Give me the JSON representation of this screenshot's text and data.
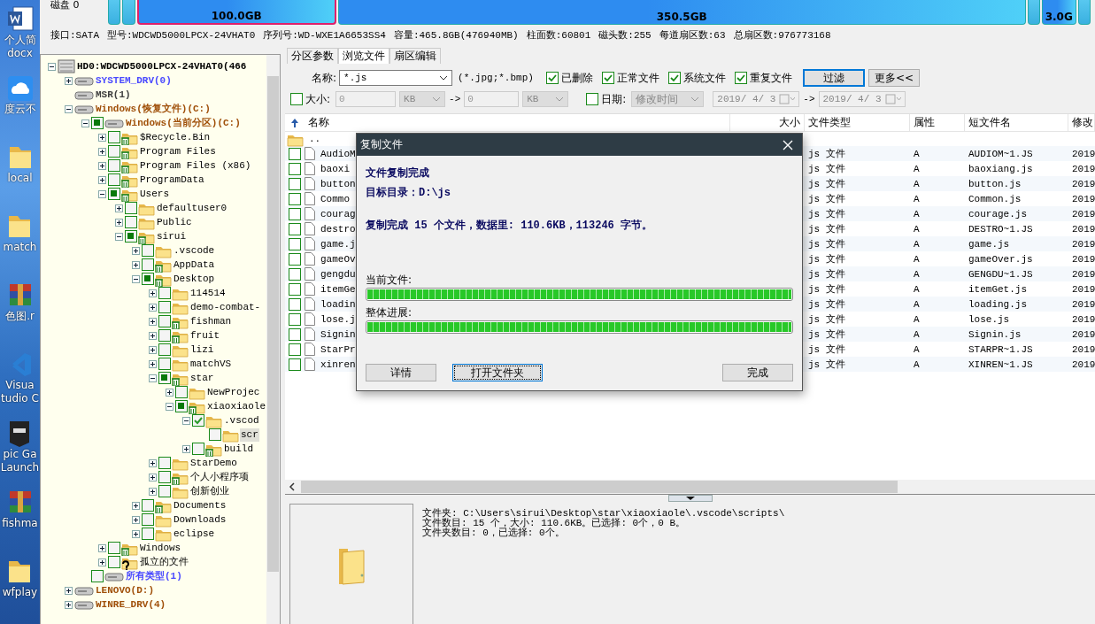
{
  "desktop_icons": [
    {
      "kind": "word",
      "lines": [
        "个人简",
        "docx"
      ]
    },
    {
      "kind": "cloud",
      "lines": [
        "度云不"
      ]
    },
    {
      "kind": "folder",
      "lines": [
        "local"
      ]
    },
    {
      "kind": "folder",
      "lines": [
        "match"
      ]
    },
    {
      "kind": "archive",
      "lines": [
        "色图.r"
      ]
    },
    {
      "kind": "code",
      "lines": [
        "Visua",
        "tudio C"
      ]
    },
    {
      "kind": "epic",
      "lines": [
        "pic Ga",
        "Launch"
      ]
    },
    {
      "kind": "archive",
      "lines": [
        "fishma"
      ]
    },
    {
      "kind": "folder",
      "lines": [
        "wfplay"
      ]
    }
  ],
  "disk_map": {
    "label": "磁盘 0",
    "partitions": [
      {
        "kind": "sliver",
        "selected": false
      },
      {
        "kind": "sliver",
        "selected": false
      },
      {
        "kind": "ntfs",
        "label": "100.0GB",
        "selected": true
      },
      {
        "kind": "ntfs",
        "label": "350.5GB",
        "selected": false
      },
      {
        "kind": "sliver",
        "selected": false
      },
      {
        "kind": "ntfs",
        "label": "3.0G",
        "selected": false
      },
      {
        "kind": "sliver",
        "selected": false
      }
    ]
  },
  "disk_info": [
    "接口:SATA",
    "型号:WDCWD5000LPCX-24VHAT0",
    "序列号:WD-WXE1A6653SS4",
    "容量:465.8GB(476940MB)",
    "柱面数:60801",
    "磁头数:255",
    "每道扇区数:63",
    "总扇区数:976773168"
  ],
  "tree": {
    "root": {
      "kind": "disk",
      "label": "HD0:WDCWD5000LPCX-24VHAT0(466",
      "expanded": true,
      "selected": false,
      "children": [
        {
          "kind": "partition",
          "label": "SYSTEM_DRV(0)",
          "color": "#4a4aff",
          "expanded": false,
          "selected": false
        },
        {
          "kind": "partition",
          "label": "MSR(1)",
          "color": "#404040",
          "selected": false
        },
        {
          "kind": "partition",
          "label": "Windows(恢复文件)(C:)",
          "color": "#a0500a",
          "expanded": true,
          "selected": false,
          "children": [
            {
              "kind": "partition",
              "label": "Windows(当前分区)(C:)",
              "color": "#a0500a",
              "checked": false,
              "partial": true,
              "expanded": true,
              "selected": false,
              "children": [
                {
                  "kind": "folder-deleted",
                  "label": "$Recycle.Bin",
                  "checked": false,
                  "partial": false,
                  "expanded": false,
                  "selected": false
                },
                {
                  "kind": "folder-deleted",
                  "label": "Program Files",
                  "checked": false,
                  "partial": false,
                  "expanded": false,
                  "selected": false
                },
                {
                  "kind": "folder-deleted",
                  "label": "Program Files (x86)",
                  "checked": false,
                  "partial": false,
                  "expanded": false,
                  "selected": false
                },
                {
                  "kind": "folder-deleted",
                  "label": "ProgramData",
                  "checked": false,
                  "partial": false,
                  "expanded": false,
                  "selected": false
                },
                {
                  "kind": "folder-deleted",
                  "label": "Users",
                  "checked": false,
                  "partial": true,
                  "expanded": true,
                  "selected": false,
                  "children": [
                    {
                      "kind": "folder",
                      "label": "defaultuser0",
                      "checked": false,
                      "partial": false,
                      "expanded": false,
                      "selected": false
                    },
                    {
                      "kind": "folder",
                      "label": "Public",
                      "checked": false,
                      "partial": false,
                      "expanded": false,
                      "selected": false
                    },
                    {
                      "kind": "folder-deleted",
                      "label": "sirui",
                      "checked": false,
                      "partial": true,
                      "expanded": true,
                      "selected": false,
                      "children": [
                        {
                          "kind": "folder",
                          "label": ".vscode",
                          "checked": false,
                          "partial": false,
                          "expanded": false,
                          "selected": false
                        },
                        {
                          "kind": "folder-deleted",
                          "label": "AppData",
                          "checked": false,
                          "partial": false,
                          "expanded": false,
                          "selected": false
                        },
                        {
                          "kind": "folder-deleted",
                          "label": "Desktop",
                          "checked": false,
                          "partial": true,
                          "expanded": true,
                          "selected": false,
                          "children": [
                            {
                              "kind": "folder",
                              "label": "114514",
                              "checked": false,
                              "partial": false,
                              "expanded": false,
                              "selected": false
                            },
                            {
                              "kind": "folder",
                              "label": "demo-combat-",
                              "checked": false,
                              "partial": false,
                              "expanded": false,
                              "selected": false
                            },
                            {
                              "kind": "folder-deleted",
                              "label": "fishman",
                              "checked": false,
                              "partial": false,
                              "expanded": false,
                              "selected": false
                            },
                            {
                              "kind": "folder-deleted",
                              "label": "fruit",
                              "checked": false,
                              "partial": false,
                              "expanded": false,
                              "selected": false
                            },
                            {
                              "kind": "folder",
                              "label": "lizi",
                              "checked": false,
                              "partial": false,
                              "expanded": false,
                              "selected": false
                            },
                            {
                              "kind": "folder",
                              "label": "matchVS",
                              "checked": false,
                              "partial": false,
                              "expanded": false,
                              "selected": false
                            },
                            {
                              "kind": "folder-deleted",
                              "label": "star",
                              "checked": false,
                              "partial": true,
                              "expanded": true,
                              "selected": false,
                              "children": [
                                {
                                  "kind": "folder",
                                  "label": "NewProjec",
                                  "checked": false,
                                  "partial": false,
                                  "expanded": false,
                                  "selected": false
                                },
                                {
                                  "kind": "folder-deleted",
                                  "label": "xiaoxiaole",
                                  "checked": false,
                                  "partial": true,
                                  "expanded": true,
                                  "selected": false,
                                  "children": [
                                    {
                                      "kind": "folder",
                                      "label": ".vscod",
                                      "checked": true,
                                      "partial": false,
                                      "expanded": true,
                                      "selected": false,
                                      "children": [
                                        {
                                          "kind": "folder",
                                          "label": "scr",
                                          "checked": false,
                                          "partial": false,
                                          "selected": true
                                        }
                                      ]
                                    },
                                    {
                                      "kind": "folder-deleted",
                                      "label": "build",
                                      "checked": false,
                                      "partial": false,
                                      "expanded": false,
                                      "selected": false
                                    }
                                  ]
                                }
                              ]
                            },
                            {
                              "kind": "folder",
                              "label": "StarDemo",
                              "checked": false,
                              "partial": false,
                              "expanded": false,
                              "selected": false
                            },
                            {
                              "kind": "folder-deleted",
                              "label": "个人小程序项",
                              "checked": false,
                              "partial": false,
                              "expanded": false,
                              "selected": false
                            },
                            {
                              "kind": "folder",
                              "label": "创新创业",
                              "checked": false,
                              "partial": false,
                              "expanded": false,
                              "selected": false
                            }
                          ]
                        },
                        {
                          "kind": "folder-deleted",
                          "label": "Documents",
                          "checked": false,
                          "partial": false,
                          "expanded": false,
                          "selected": false
                        },
                        {
                          "kind": "folder",
                          "label": "Downloads",
                          "checked": false,
                          "partial": false,
                          "expanded": false,
                          "selected": false
                        },
                        {
                          "kind": "folder",
                          "label": "eclipse",
                          "checked": false,
                          "partial": false,
                          "expanded": false,
                          "selected": false
                        }
                      ]
                    }
                  ]
                },
                {
                  "kind": "folder-deleted",
                  "label": "Windows",
                  "checked": false,
                  "partial": false,
                  "expanded": false,
                  "selected": false
                },
                {
                  "kind": "orphan",
                  "label": "孤立的文件",
                  "checked": false,
                  "partial": false,
                  "expanded": false,
                  "selected": false
                }
              ]
            },
            {
              "kind": "partition",
              "label": "所有类型(1)",
              "color": "#4a4aff",
              "checked": false,
              "partial": false,
              "selected": false
            }
          ]
        },
        {
          "kind": "partition",
          "label": "LENOVO(D:)",
          "color": "#a0500a",
          "expanded": false,
          "selected": false
        },
        {
          "kind": "partition",
          "label": "WINRE_DRV(4)",
          "color": "#a0500a",
          "expanded": false,
          "selected": false
        }
      ]
    }
  },
  "tabs": [
    {
      "label": "分区参数",
      "selected": false
    },
    {
      "label": "浏览文件",
      "selected": true
    },
    {
      "label": "扇区编辑",
      "selected": false
    }
  ],
  "filter": {
    "name_label": "名称:",
    "name_value": "*.js",
    "name_hint": "(*.jpg;*.bmp)",
    "checks": [
      {
        "label": "已删除",
        "checked": true
      },
      {
        "label": "正常文件",
        "checked": true
      },
      {
        "label": "系统文件",
        "checked": true
      },
      {
        "label": "重复文件",
        "checked": true
      }
    ],
    "buttons": [
      {
        "label": "过滤",
        "focused": true
      },
      {
        "label": "更多<<",
        "focused": false
      }
    ],
    "size": {
      "label": "大小:",
      "checked": false,
      "from": "0",
      "from_unit": "KB",
      "arrow": "->",
      "to": "0",
      "to_unit": "KB"
    },
    "date": {
      "label": "日期:",
      "checked": false,
      "field": "修改时间",
      "from": "2019/ 4/ 3",
      "arrow": "->",
      "to": "2019/ 4/ 3"
    }
  },
  "table": {
    "columns": [
      "名称",
      "大小",
      "文件类型",
      "属性",
      "短文件名",
      "修改"
    ],
    "parent_row": "..",
    "rows": [
      {
        "name": "AudioM",
        "type": "js 文件",
        "attr": "A",
        "short": "AUDIOM~1.JS",
        "modified": "2019",
        "checked": false
      },
      {
        "name": "baoxi",
        "type": "js 文件",
        "attr": "A",
        "short": "baoxiang.js",
        "modified": "2019",
        "checked": false
      },
      {
        "name": "button",
        "type": "js 文件",
        "attr": "A",
        "short": "button.js",
        "modified": "2019",
        "checked": false
      },
      {
        "name": "Commo",
        "type": "js 文件",
        "attr": "A",
        "short": "Common.js",
        "modified": "2019",
        "checked": false
      },
      {
        "name": "courag",
        "type": "js 文件",
        "attr": "A",
        "short": "courage.js",
        "modified": "2019",
        "checked": false
      },
      {
        "name": "destro",
        "type": "js 文件",
        "attr": "A",
        "short": "DESTRO~1.JS",
        "modified": "2019",
        "checked": false
      },
      {
        "name": "game.j",
        "type": "js 文件",
        "attr": "A",
        "short": "game.js",
        "modified": "2019",
        "checked": false
      },
      {
        "name": "gameOv",
        "type": "js 文件",
        "attr": "A",
        "short": "gameOver.js",
        "modified": "2019",
        "checked": false
      },
      {
        "name": "gengdu",
        "type": "js 文件",
        "attr": "A",
        "short": "GENGDU~1.JS",
        "modified": "2019",
        "checked": false
      },
      {
        "name": "itemGe",
        "type": "js 文件",
        "attr": "A",
        "short": "itemGet.js",
        "modified": "2019",
        "checked": false
      },
      {
        "name": "loadin",
        "type": "js 文件",
        "attr": "A",
        "short": "loading.js",
        "modified": "2019",
        "checked": false
      },
      {
        "name": "lose.j",
        "type": "js 文件",
        "attr": "A",
        "short": "lose.js",
        "modified": "2019",
        "checked": false
      },
      {
        "name": "Signin",
        "type": "js 文件",
        "attr": "A",
        "short": "Signin.js",
        "modified": "2019",
        "checked": false
      },
      {
        "name": "StarPr",
        "type": "js 文件",
        "attr": "A",
        "short": "STARPR~1.JS",
        "modified": "2019",
        "checked": false
      },
      {
        "name": "xinren",
        "type": "js 文件",
        "attr": "A",
        "short": "XINREN~1.JS",
        "modified": "2019",
        "checked": false
      }
    ]
  },
  "dialog": {
    "title": "复制文件",
    "heading": "文件复制完成",
    "target": "目标目录：D:\\js",
    "summary": "复制完成 15 个文件，数据里: 110.6KB，113246 字节。",
    "progress": [
      {
        "label": "当前文件:",
        "level": 1
      },
      {
        "label": "整体进展:",
        "level": 1
      }
    ],
    "buttons": [
      {
        "label": "详情",
        "focused": false
      },
      {
        "label": "打开文件夹",
        "focused": true
      },
      {
        "label": "完成",
        "focused": false
      }
    ]
  },
  "info": {
    "lines": [
      "文件夹: C:\\Users\\sirui\\Desktop\\star\\xiaoxiaole\\.vscode\\scripts\\",
      "文件数目: 15 个，大小: 110.6KB。已选择: 0个，0 B。",
      "文件夹数目: 0，已选择: 0个。"
    ]
  }
}
